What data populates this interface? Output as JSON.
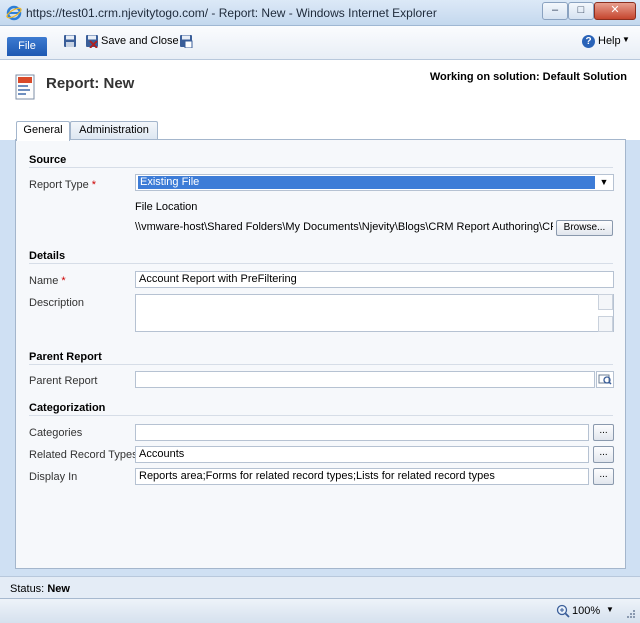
{
  "window": {
    "title": "https://test01.crm.njevitytogo.com/ - Report: New - Windows Internet Explorer",
    "minimize": "–",
    "maximize": "□",
    "close": "✕"
  },
  "toolbar": {
    "file_label": "File",
    "save_and_close_label": "Save and Close",
    "help_label": "Help"
  },
  "header": {
    "title": "Report: New",
    "solution": "Working on solution: Default Solution"
  },
  "tabs": [
    {
      "label": "General",
      "active": true
    },
    {
      "label": "Administration",
      "active": false
    }
  ],
  "form": {
    "source": {
      "title": "Source",
      "report_type_label": "Report Type",
      "report_type_value": "Existing File",
      "file_location_label": "File Location",
      "file_location_value": "\\\\vmware-host\\Shared Folders\\My Documents\\Njevity\\Blogs\\CRM Report Authoring\\CRM Re",
      "browse_label": "Browse..."
    },
    "details": {
      "title": "Details",
      "name_label": "Name",
      "name_value": "Account Report with PreFiltering",
      "description_label": "Description",
      "description_value": ""
    },
    "parent": {
      "title": "Parent Report",
      "parent_label": "Parent Report",
      "parent_value": ""
    },
    "categorization": {
      "title": "Categorization",
      "categories_label": "Categories",
      "categories_value": "",
      "related_label": "Related Record Types",
      "related_value": "Accounts",
      "display_label": "Display In",
      "display_value": "Reports area;Forms for related record types;Lists for related record types",
      "dots_label": "..."
    }
  },
  "status": {
    "label": "Status:",
    "value": "New"
  },
  "ie_status": {
    "zoom": "100%"
  },
  "required_marker": "*"
}
